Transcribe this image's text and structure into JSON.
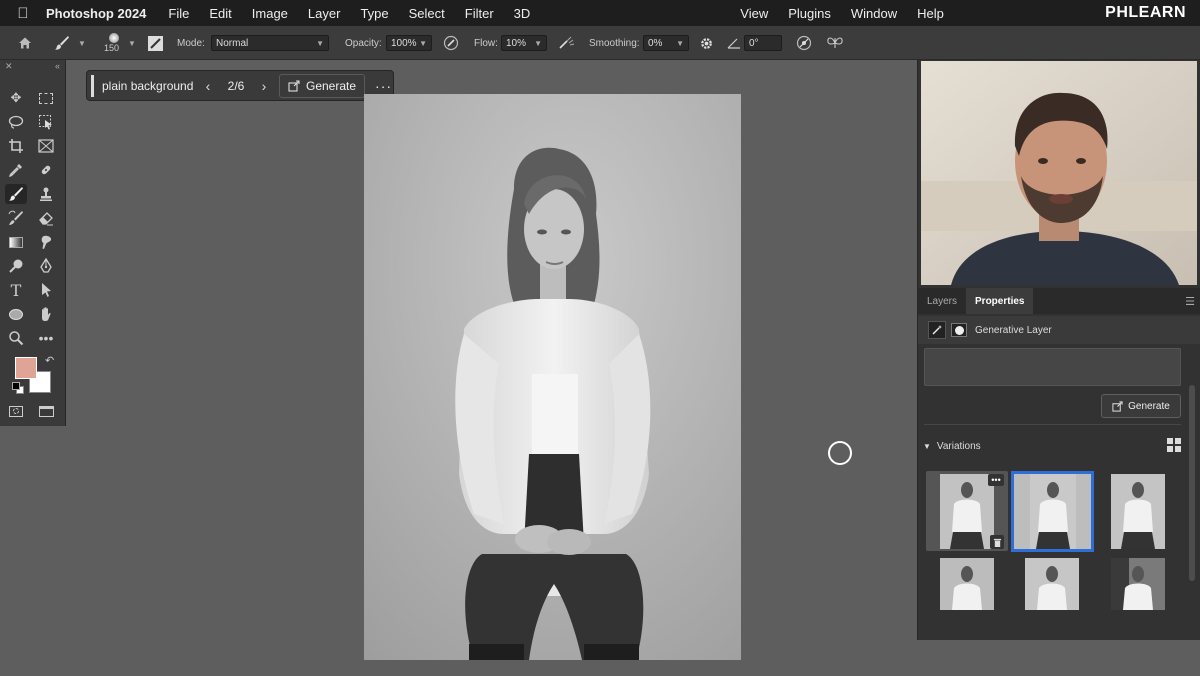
{
  "menubar": {
    "app_name": "Photoshop 2024",
    "menus_left": [
      "File",
      "Edit",
      "Image",
      "Layer",
      "Type",
      "Select",
      "Filter",
      "3D"
    ],
    "menus_right": [
      "View",
      "Plugins",
      "Window",
      "Help"
    ],
    "brand": "PHLEARN"
  },
  "options_bar": {
    "brush_size": "150",
    "mode_label": "Mode:",
    "mode_value": "Normal",
    "opacity_label": "Opacity:",
    "opacity_value": "100%",
    "flow_label": "Flow:",
    "flow_value": "10%",
    "smoothing_label": "Smoothing:",
    "smoothing_value": "0%",
    "angle_value": "0°"
  },
  "taskbar": {
    "prompt": "plain background",
    "counter": "2/6",
    "generate_label": "Generate",
    "more": "···"
  },
  "colors": {
    "foreground": "#e0a496",
    "background": "#ffffff",
    "selection_accent": "#2d6fd6"
  },
  "panel": {
    "tabs": [
      "Layers",
      "Properties"
    ],
    "active_tab": "Properties",
    "layer_name": "Generative Layer",
    "generate_label": "Generate",
    "variations_label": "Variations",
    "selected_variation": 2
  }
}
